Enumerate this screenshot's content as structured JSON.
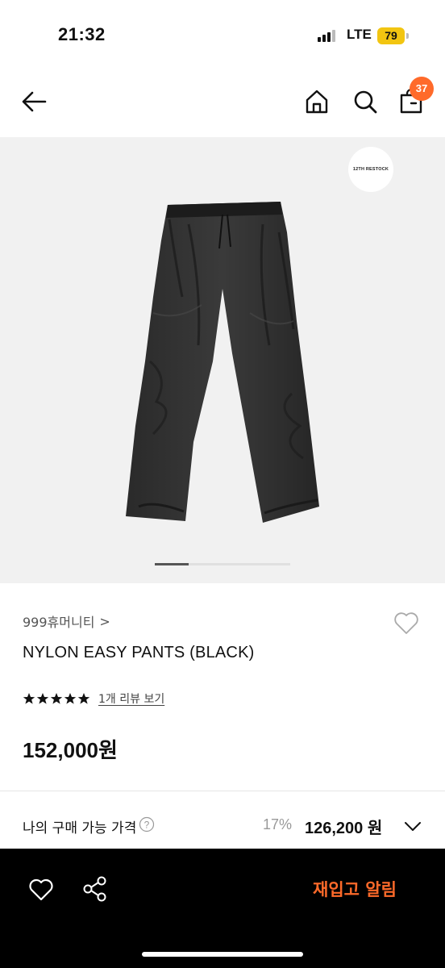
{
  "status_bar": {
    "time": "21:32",
    "network": "LTE",
    "battery": "79"
  },
  "nav": {
    "cart_count": "37",
    "icons": [
      "back-arrow-icon",
      "home-icon",
      "search-icon",
      "shopping-bag-icon"
    ]
  },
  "gallery": {
    "badge_text": "12TH RESTOCK",
    "image_index": 1,
    "image_count": 4
  },
  "product": {
    "brand": "999휴머니티",
    "brand_chevron": ">",
    "name": "NYLON EASY PANTS (BLACK)",
    "rating_stars": 5,
    "review_link": "1개 리뷰 보기",
    "price": "152,000원"
  },
  "purchase": {
    "label": "나의 구매 가능 가격",
    "discount": "17%",
    "final_price": "126,200 원"
  },
  "bottom_bar": {
    "restock_button": "재입고 알림",
    "accent_color": "#ff6a2a"
  }
}
